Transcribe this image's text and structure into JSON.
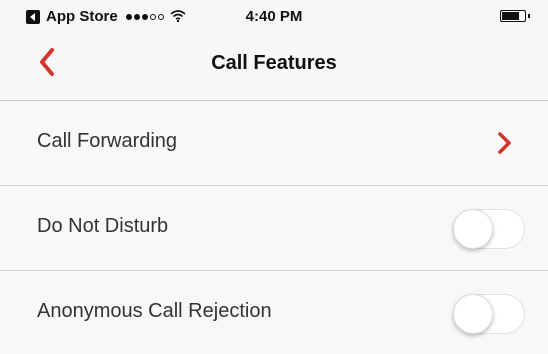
{
  "status_bar": {
    "back_app": "App Store",
    "time": "4:40 PM",
    "signal_filled": 3,
    "signal_total": 5,
    "battery_level": 0.7
  },
  "navbar": {
    "title": "Call Features",
    "back_icon": "chevron-left-icon",
    "accent_color": "#d0342c"
  },
  "settings": [
    {
      "label": "Call Forwarding",
      "control": "chevron"
    },
    {
      "label": "Do Not Disturb",
      "control": "toggle",
      "on": false
    },
    {
      "label": "Anonymous Call Rejection",
      "control": "toggle",
      "on": false
    }
  ]
}
